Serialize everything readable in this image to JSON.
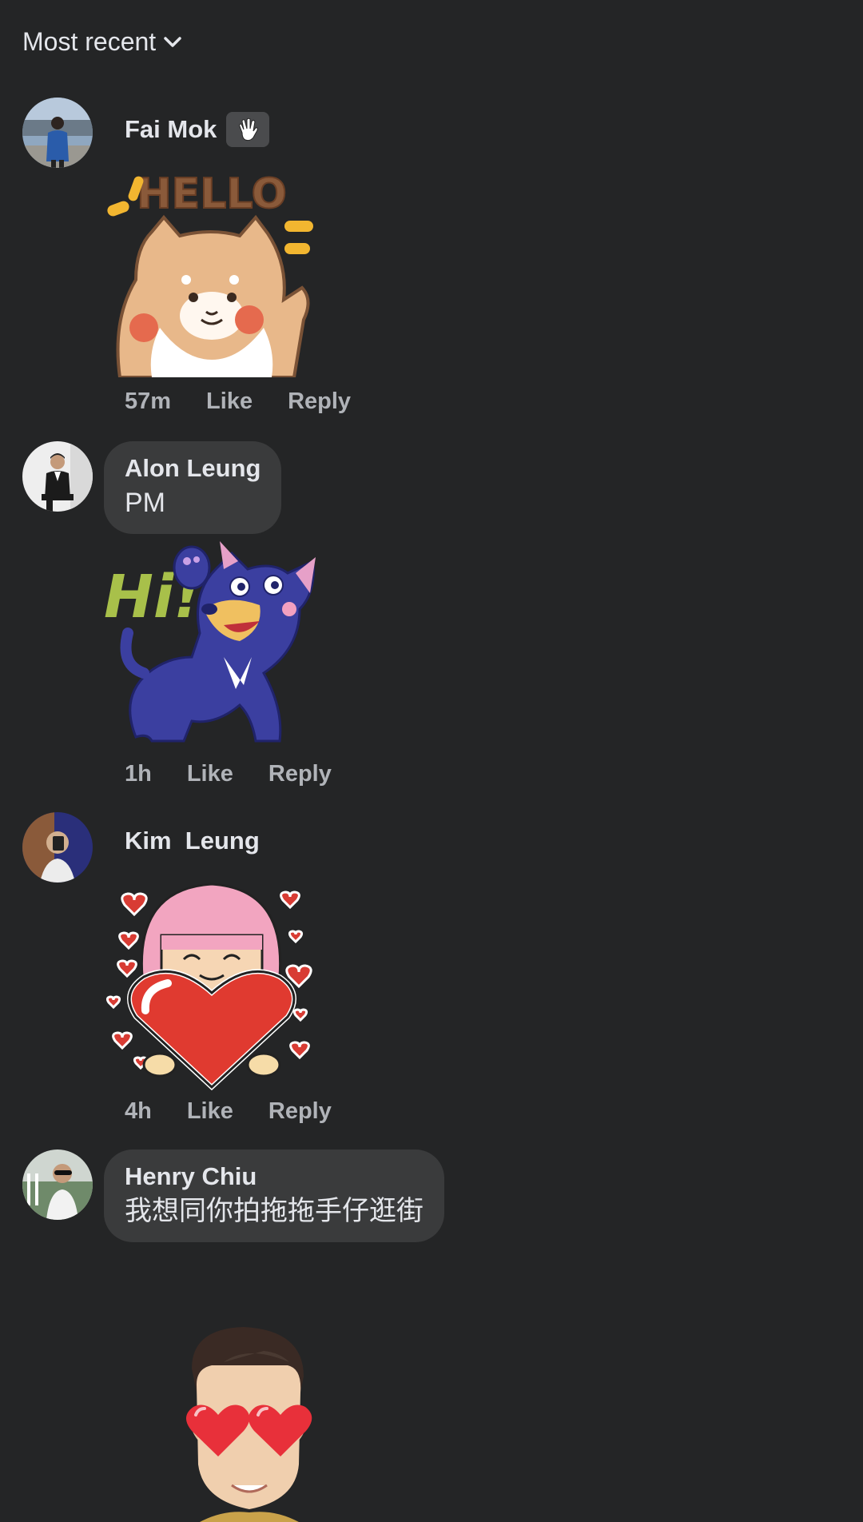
{
  "sort": {
    "label": "Most recent",
    "icon": "chevron-down-icon"
  },
  "comments": [
    {
      "author": "Fai Mok",
      "badge_icon": "waving-hand-icon",
      "sticker": "hello-shiba-dog-sticker",
      "sticker_text": "HELLO",
      "time": "57m",
      "like": "Like",
      "reply": "Reply"
    },
    {
      "author": "Alon Leung",
      "text": "PM",
      "sticker": "hi-purple-bear-sticker",
      "sticker_text": "Hi!",
      "time": "1h",
      "like": "Like",
      "reply": "Reply"
    },
    {
      "author": "Kim  Leung",
      "sticker": "girl-holding-heart-sticker",
      "time": "4h",
      "like": "Like",
      "reply": "Reply"
    },
    {
      "author": "Henry Chiu",
      "text": "我想同你拍拖拖手仔逛街",
      "sticker": "heart-eyes-avatar-sticker"
    }
  ],
  "colors": {
    "background": "#242526",
    "bubble": "#3a3b3c",
    "primary_text": "#e4e6eb",
    "secondary_text": "#b0b3b8"
  }
}
